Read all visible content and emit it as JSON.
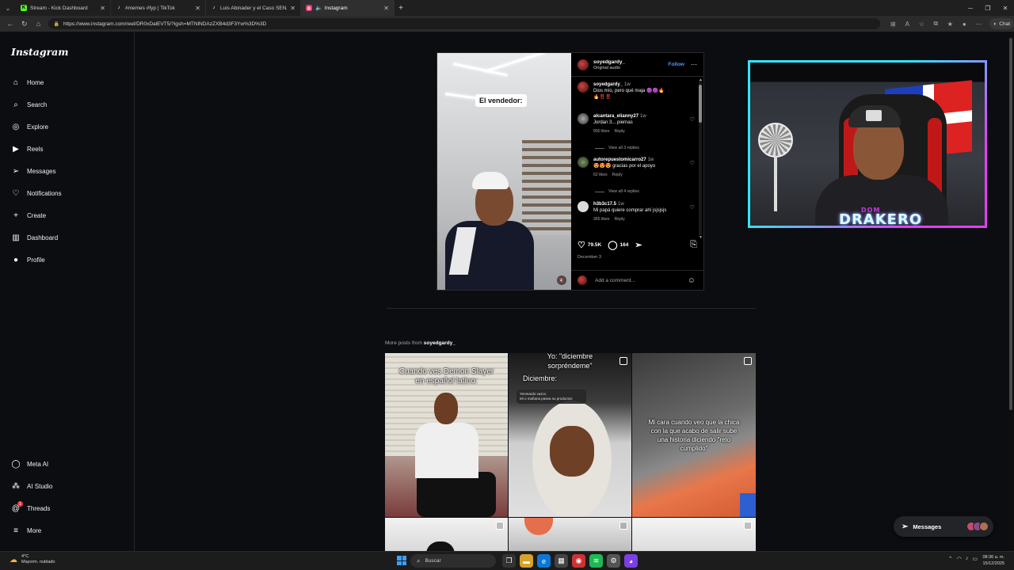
{
  "browser": {
    "tabs": [
      {
        "label": "Stream - Kick Dashboard",
        "favicon": "K",
        "color": "#53fc18"
      },
      {
        "label": "#memes #fyp | TikTok",
        "favicon": "♪",
        "color": "#111111"
      },
      {
        "label": "Luis Abinader y el Caso SENASA: ...",
        "favicon": "♪",
        "color": "#111111"
      },
      {
        "label": "Instagram",
        "favicon": "◎",
        "color": "#e1306c",
        "active": true
      }
    ],
    "url": "https://www.instagram.com/reel/DR0xDalEVT5/?igsh=MTNlNDAzZXB4d3F3Yw%3D%3D",
    "chat_label": "Chat"
  },
  "sidebar": {
    "logo": "Instagram",
    "items": [
      {
        "label": "Home",
        "icon": "home-icon"
      },
      {
        "label": "Search",
        "icon": "search-icon"
      },
      {
        "label": "Explore",
        "icon": "compass-icon"
      },
      {
        "label": "Reels",
        "icon": "reels-icon"
      },
      {
        "label": "Messages",
        "icon": "messenger-icon"
      },
      {
        "label": "Notifications",
        "icon": "heart-icon"
      },
      {
        "label": "Create",
        "icon": "plus-icon"
      },
      {
        "label": "Dashboard",
        "icon": "dashboard-icon"
      },
      {
        "label": "Profile",
        "icon": "profile-icon"
      }
    ],
    "bottom_items": [
      {
        "label": "Meta AI",
        "icon": "meta-ai-icon"
      },
      {
        "label": "AI Studio",
        "icon": "ai-studio-icon"
      },
      {
        "label": "Threads",
        "icon": "threads-icon",
        "badge": "1"
      },
      {
        "label": "More",
        "icon": "menu-icon"
      }
    ]
  },
  "post": {
    "overlay_caption": "El vendedor:",
    "username": "soyedgardy_",
    "audio": "Original audio",
    "follow_label": "Follow",
    "caption": {
      "username": "soyedgardy_",
      "time": "1w",
      "text": "Dios mío, pero qué maja 🟣🟣🔥",
      "emoji_line": "🔥‼️‼️"
    },
    "comments": [
      {
        "username": "alcantara_elianny27",
        "time": "1w",
        "text": "Jordan 3... piernas",
        "likes": "990 likes",
        "reply": "Reply",
        "view_replies": "View all 3 replies"
      },
      {
        "username": "autorepuestomicarro27",
        "time": "1w",
        "text": "😍😍😍 gracias por el apoyo",
        "likes": "62 likes",
        "reply": "Reply",
        "view_replies": "View all 4 replies"
      },
      {
        "username": "h3b3c17.5",
        "time": "1w",
        "text": "Mi papá quiere comprar ahí jsjsjsjs",
        "likes": "365 likes",
        "reply": "Reply"
      }
    ],
    "likes_count": "79.5K",
    "comments_count": "164",
    "date": "December 3",
    "add_comment_placeholder": "Add a comment..."
  },
  "more_posts": {
    "prefix": "More posts from",
    "username": "soyedgardy_",
    "tiles": [
      {
        "caption": "Cuando ves Demon Slayer en español latino:"
      },
      {
        "caption_top": "Yo: \"diciembre sorpréndeme\"",
        "caption": "Diciembre:",
        "notification_title": "Yenmardo vazco",
        "notification_text": "Mi o mañana pasea su productos"
      },
      {
        "caption": "Mi cara cuando veo que la chica con la que acabo de salir sube una historia diciendo \"reto cumplido\""
      }
    ]
  },
  "webcam": {
    "logo_small": "DOM",
    "logo_main": "DRAKERO"
  },
  "messages_float": {
    "label": "Messages"
  },
  "taskbar": {
    "weather_temp": "4°C",
    "weather_desc": "Mayorm. nublado",
    "search_placeholder": "Buscar",
    "time": "08:36 a. m.",
    "date": "15/12/2025"
  },
  "colors": {
    "accent_blue": "#4a9dff",
    "badge_red": "#ff3040",
    "cam_border_cyan": "#2fe6ff",
    "cam_border_magenta": "#e23ff0"
  }
}
